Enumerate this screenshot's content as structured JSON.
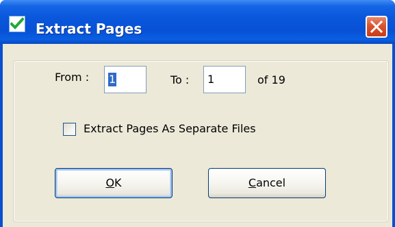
{
  "window": {
    "title": "Extract Pages",
    "title_icon": "green-checkmark-icon",
    "close_icon": "close-x-icon",
    "title_bar_color": "#0851d6",
    "close_button_color": "#d9542e"
  },
  "range": {
    "from_label": "From :",
    "from_value": "1",
    "to_label": "To :",
    "to_value": "1",
    "of_label": "of 19"
  },
  "options": {
    "separate_files_label": "Extract Pages As Separate Files",
    "separate_files_checked": false
  },
  "buttons": {
    "ok_accel": "O",
    "ok_rest": "K",
    "cancel_accel": "C",
    "cancel_rest": "ancel"
  }
}
